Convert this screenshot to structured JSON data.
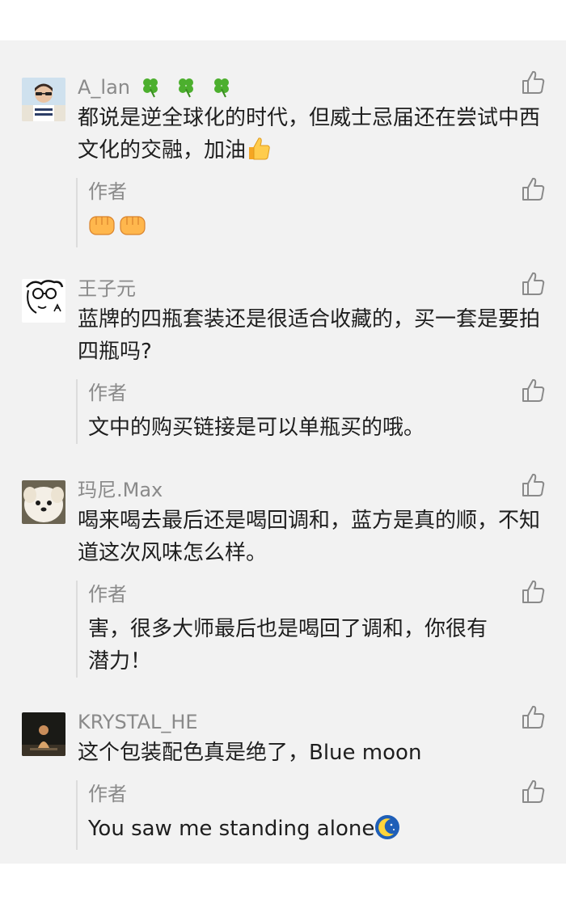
{
  "comments": [
    {
      "avatar": "person-with-sunglasses-avatar",
      "name": "A_lan",
      "name_emoji": "four-leaf-clover-icon",
      "text": "都说是逆全球化的时代，但威士忌届还在尝试中西文化的交融，加油",
      "text_emoji": "thumbs-up-emoji",
      "reply": {
        "label": "作者",
        "text": "",
        "emoji": "raised-fist-emoji"
      }
    },
    {
      "avatar": "sketch-face-avatar",
      "name": "王子元",
      "text": "蓝牌的四瓶套装还是很适合收藏的，买一套是要拍四瓶吗?",
      "reply": {
        "label": "作者",
        "text": "文中的购买链接是可以单瓶买的哦。"
      }
    },
    {
      "avatar": "fluffy-dog-avatar",
      "name": "玛尼.Max",
      "text": "喝来喝去最后还是喝回调和，蓝方是真的顺，不知道这次风味怎么样。",
      "reply": {
        "label": "作者",
        "text": "害，很多大师最后也是喝回了调和，你很有潜力！"
      }
    },
    {
      "avatar": "dark-photo-avatar",
      "name": "KRYSTAL_HE",
      "text": "这个包装配色真是绝了，Blue moon",
      "reply": {
        "label": "作者",
        "text": "You saw me standing alone",
        "emoji": "crescent-moon-emoji"
      }
    }
  ],
  "icons": {
    "like": "thumbs-up-outline-icon"
  },
  "colors": {
    "background": "#f2f2f2",
    "name": "#8a8a8a",
    "text": "#1e1e1e",
    "icon": "#8a8a8a"
  }
}
